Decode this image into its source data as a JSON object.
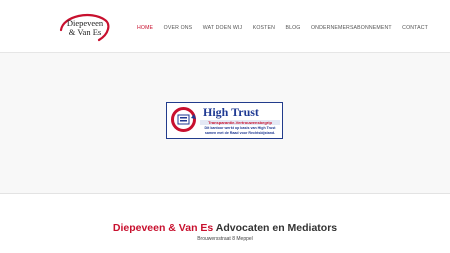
{
  "logo": {
    "line1": "Diepeveen",
    "line2": "& Van Es",
    "swoosh_color": "#c8102e"
  },
  "nav": {
    "items": [
      {
        "label": "HOME",
        "active": true
      },
      {
        "label": "OVER ONS",
        "active": false
      },
      {
        "label": "WAT DOEN WIJ",
        "active": false
      },
      {
        "label": "KOSTEN",
        "active": false
      },
      {
        "label": "BLOG",
        "active": false
      },
      {
        "label": "ONDERNEMERSABONNEMENT",
        "active": false
      },
      {
        "label": "CONTACT",
        "active": false
      }
    ],
    "active_color": "#c8102e"
  },
  "badge": {
    "title": "High Trust",
    "bar_text": "Transparantie-Vertrouwensbegrip",
    "sub1": "Dit kantoor werkt op basis van High Trust",
    "sub2": "samen met de Raad voor Rechtsbijstand."
  },
  "main": {
    "title_accent": "Diepeveen & Van Es",
    "title_rest": " Advocaten en Mediators",
    "address": "Brouwersstraat 8 Meppel"
  },
  "colors": {
    "accent": "#c8102e",
    "hero_bg": "#f8f8f8"
  }
}
